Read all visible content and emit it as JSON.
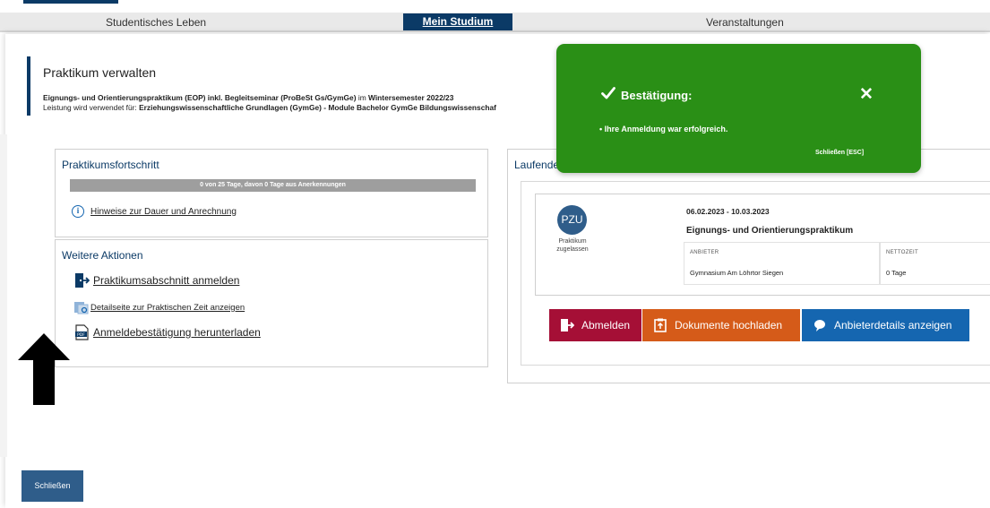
{
  "nav": {
    "items": [
      "Studentisches Leben",
      "Mein Studium",
      "Veranstaltungen"
    ],
    "active": "Mein Studium"
  },
  "header": {
    "title": "Praktikum verwalten",
    "line1_bold": "Eignungs- und Orientierungspraktikum (EOP) inkl. Begleitseminar (ProBeSt Gs/GymGe)",
    "line1_mid": " im ",
    "line1_term": "Wintersemester 2022/23",
    "line2_prefix": "Leistung wird verwendet für: ",
    "line2_bold": "Erziehungswissenschaftliche Grundlagen (GymGe) - Module Bachelor GymGe Bildungswissenschaf"
  },
  "progress": {
    "title": "Praktikumsfortschritt",
    "bar_text": "0 von 25 Tage, davon 0 Tage aus Anerkennungen",
    "fraction": 0,
    "hint_link": "Hinweise zur Dauer und Anrechnung",
    "info_icon_glyph": "i"
  },
  "actions": {
    "title": "Weitere Aktionen",
    "items": [
      {
        "label": "Praktikumsabschnitt anmelden",
        "icon": "door-enter-icon"
      },
      {
        "label": "Detailseite zur Praktischen Zeit anzeigen",
        "icon": "file-detail-icon"
      },
      {
        "label": "Anmeldebestätigung herunterladen",
        "icon": "pdf-file-icon"
      }
    ]
  },
  "running": {
    "title": "Laufende",
    "status_code": "PZU",
    "status_text": "Praktikum zugelassen",
    "dates": "06.02.2023 - 10.03.2023",
    "name": "Eignungs- und Orientierungspraktikum",
    "provider_label": "ANBIETER",
    "provider_value": "Gymnasium Am Löhrtor Siegen",
    "net_label": "NETTOZEIT",
    "net_value": "0 Tage",
    "buttons": {
      "abmelden": "Abmelden",
      "docs": "Dokumente hochladen",
      "details": "Anbieterdetails anzeigen"
    }
  },
  "toast": {
    "title": "Bestätigung:",
    "close_glyph": "✕",
    "message": "• Ihre Anmeldung war erfolgreich.",
    "footer": "Schließen [ESC]"
  },
  "footer": {
    "close_label": "Schließen"
  },
  "colors": {
    "primary": "#0b3a66",
    "toast_green": "#2a8f16",
    "abmelden": "#a50f36",
    "docs": "#d55b19",
    "details": "#1566b0"
  }
}
